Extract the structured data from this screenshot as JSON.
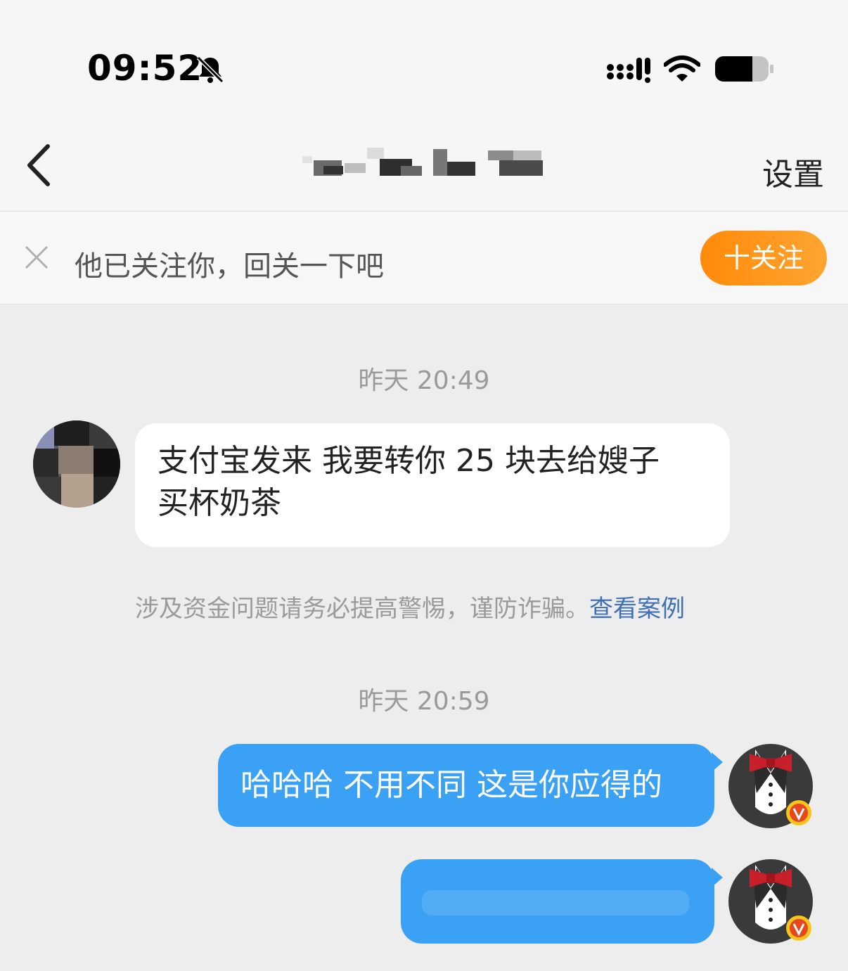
{
  "status_bar": {
    "time": "09:52",
    "icons": [
      "bell-muted-icon",
      "signal-icon",
      "wifi-icon",
      "battery-icon"
    ]
  },
  "nav": {
    "back_icon": "chevron-left-icon",
    "settings_label": "设置"
  },
  "follow_banner": {
    "close_icon": "close-icon",
    "text": "他已关注你，回关一下吧",
    "button_label": "十关注"
  },
  "messages": [
    {
      "timestamp": "昨天 20:49"
    },
    {
      "from": "other",
      "text_line1": "支付宝发来 我要转你 25 块去给嫂子",
      "text_line2": "买杯奶茶"
    },
    {
      "warning_text": "涉及资金问题请务必提高警惕，谨防诈骗。",
      "warning_link": "查看案例"
    },
    {
      "timestamp": "昨天 20:59"
    },
    {
      "from": "me",
      "text": "哈哈哈 不用不同 这是你应得的"
    },
    {
      "from": "me",
      "text": ""
    }
  ],
  "colors": {
    "accent_orange": "#ff9a1f",
    "bubble_blue": "#3aa1f5",
    "link_blue": "#3f6fb5",
    "chat_bg": "#ededed"
  }
}
